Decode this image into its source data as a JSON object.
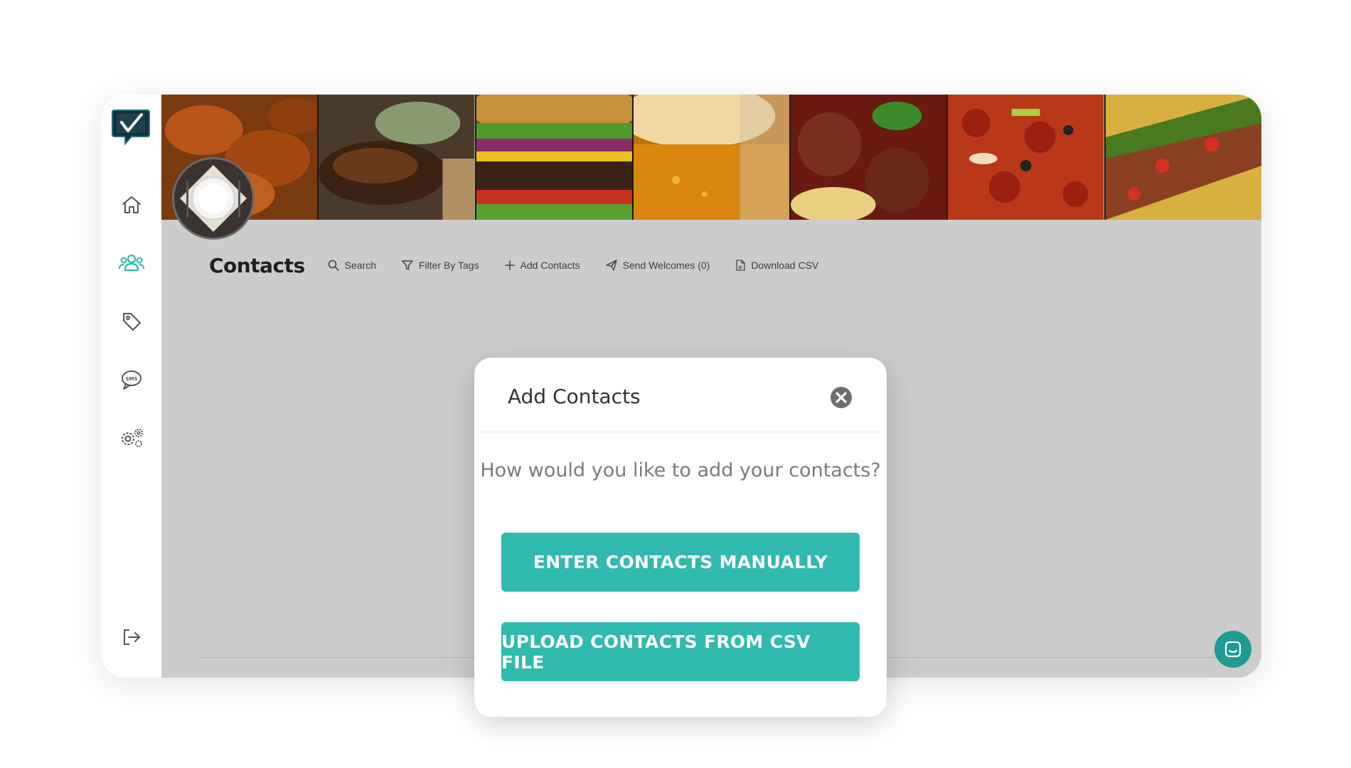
{
  "page": {
    "title": "Contacts"
  },
  "sidebar": {
    "items": [
      {
        "name": "home-icon",
        "active": false
      },
      {
        "name": "contacts-icon",
        "active": true
      },
      {
        "name": "tags-icon",
        "active": false
      },
      {
        "name": "sms-icon",
        "active": false
      },
      {
        "name": "settings-icon",
        "active": false
      },
      {
        "name": "logout-icon",
        "active": false
      }
    ]
  },
  "toolbar": {
    "search": "Search",
    "filter": "Filter By Tags",
    "add": "Add Contacts",
    "send": "Send Welcomes (0)",
    "download": "Download CSV"
  },
  "modal": {
    "title": "Add Contacts",
    "question": "How would you like to add your contacts?",
    "manual_button": "ENTER CONTACTS MANUALLY",
    "csv_button": "UPLOAD CONTACTS FROM CSV FILE"
  },
  "colors": {
    "accent": "#2fbaad",
    "chat_button": "#1f9a93",
    "overlay": "#cccccc",
    "brand_dark": "#1e4050"
  }
}
